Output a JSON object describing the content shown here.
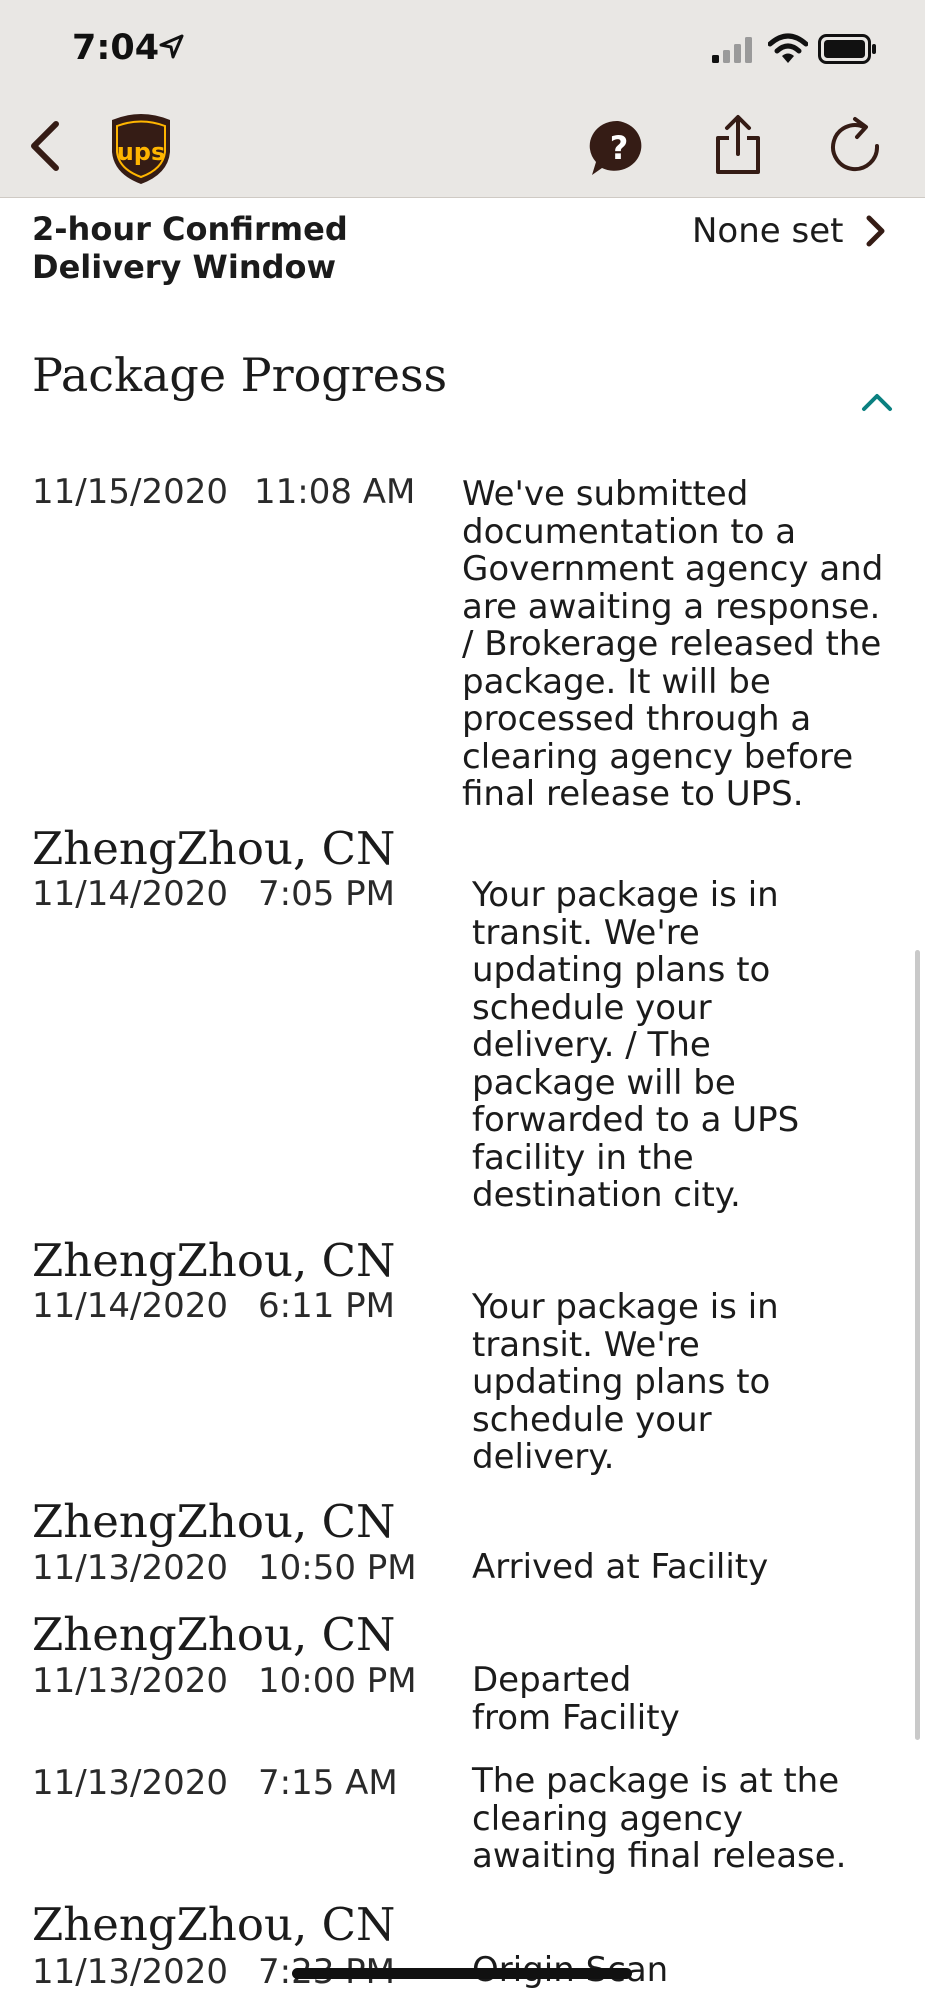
{
  "status_bar": {
    "time": "7:04"
  },
  "nav": {
    "back_icon": "chevron-left-icon",
    "logo": "ups-logo",
    "help_icon": "question-bubble-icon",
    "share_icon": "share-icon",
    "refresh_icon": "refresh-icon"
  },
  "delivery_window": {
    "label": "2-hour Confirmed Delivery Window",
    "value": "None set"
  },
  "progress": {
    "title": "Package Progress",
    "entries": [
      {
        "location": "",
        "date": "11/15/2020",
        "time": "11:08 AM",
        "description": "We've submitted documentation to a Government agency and are awaiting a response. / Brokerage released the package. It will be processed through a clearing agency before final release to UPS."
      },
      {
        "location": "ZhengZhou, CN",
        "date": "11/14/2020",
        "time": "7:05 PM",
        "description": "Your package is in transit. We're updating plans to schedule your delivery. / The package will be forwarded to a UPS facility in the destination city."
      },
      {
        "location": "ZhengZhou, CN",
        "date": "11/14/2020",
        "time": "6:11 PM",
        "description": "Your package is in transit. We're updating plans to schedule your delivery."
      },
      {
        "location": "ZhengZhou, CN",
        "date": "11/13/2020",
        "time": "10:50 PM",
        "description": "Arrived at Facility"
      },
      {
        "location": "ZhengZhou, CN",
        "date": "11/13/2020",
        "time": "10:00 PM",
        "description": "Departed from Facility"
      },
      {
        "location": "",
        "date": "11/13/2020",
        "time": "7:15 AM",
        "description": "The package is at the clearing agency awaiting final release."
      },
      {
        "location": "ZhengZhou, CN",
        "date": "11/13/2020",
        "time": "7:23 PM",
        "description": "Origin Scan"
      }
    ]
  },
  "colors": {
    "header_bg": "#e9e7e4",
    "ups_brown": "#351c15",
    "ups_gold": "#ffb500",
    "accent_teal": "#0a8080"
  }
}
